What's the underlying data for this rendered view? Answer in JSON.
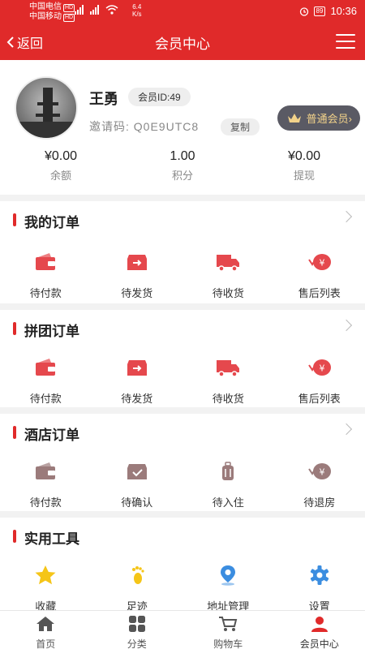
{
  "status_bar": {
    "carrier1": "中国电信",
    "carrier2": "中国移动",
    "hd": "HD",
    "speed_value": "6.4",
    "speed_unit": "K/s",
    "battery": "89",
    "time": "10:36"
  },
  "header": {
    "back_label": "返回",
    "title": "会员中心"
  },
  "profile": {
    "name": "王勇",
    "member_id": "会员ID:49",
    "invite_code": "邀请码: Q0E9UTC8",
    "copy_label": "复制",
    "level_label": "普通会员›"
  },
  "stats": [
    {
      "value": "¥0.00",
      "label": "余额"
    },
    {
      "value": "1.00",
      "label": "积分"
    },
    {
      "value": "¥0.00",
      "label": "提现"
    }
  ],
  "sections": [
    {
      "title": "我的订单",
      "items": [
        {
          "label": "待付款",
          "icon": "wallet-icon"
        },
        {
          "label": "待发货",
          "icon": "box-arrow-icon"
        },
        {
          "label": "待收货",
          "icon": "truck-icon"
        },
        {
          "label": "售后列表",
          "icon": "refund-icon"
        }
      ]
    },
    {
      "title": "拼团订单",
      "items": [
        {
          "label": "待付款",
          "icon": "wallet-icon"
        },
        {
          "label": "待发货",
          "icon": "box-arrow-icon"
        },
        {
          "label": "待收货",
          "icon": "truck-icon"
        },
        {
          "label": "售后列表",
          "icon": "refund-icon"
        }
      ]
    },
    {
      "title": "酒店订单",
      "items": [
        {
          "label": "待付款",
          "icon": "wallet-icon"
        },
        {
          "label": "待确认",
          "icon": "box-check-icon"
        },
        {
          "label": "待入住",
          "icon": "luggage-icon"
        },
        {
          "label": "待退房",
          "icon": "refund-icon"
        }
      ]
    },
    {
      "title": "实用工具",
      "items": [
        {
          "label": "收藏",
          "icon": "star-icon"
        },
        {
          "label": "足迹",
          "icon": "footprint-icon"
        },
        {
          "label": "地址管理",
          "icon": "location-pin-icon"
        },
        {
          "label": "设置",
          "icon": "gear-icon"
        }
      ]
    }
  ],
  "bottom_nav": [
    {
      "label": "首页",
      "icon": "home-icon"
    },
    {
      "label": "分类",
      "icon": "category-icon"
    },
    {
      "label": "购物车",
      "icon": "cart-icon"
    },
    {
      "label": "会员中心",
      "icon": "member-icon",
      "active": true
    }
  ],
  "colors": {
    "brand_red": "#e02a2a",
    "order_icon_red": "#e5484d",
    "hotel_icon_brown": "#9b7b7b",
    "tool_yellow": "#f5c518",
    "tool_blue": "#3b8de0",
    "level_gold": "#f2d28a",
    "level_bg": "#5a5a64"
  }
}
